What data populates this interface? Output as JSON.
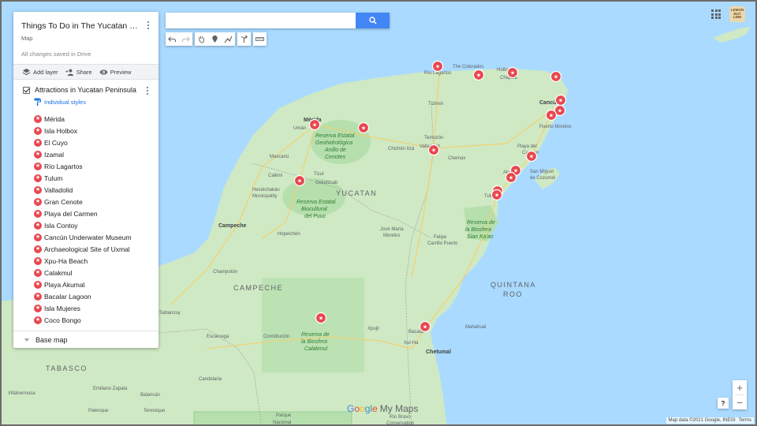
{
  "map_name": "Things To Do in The Yucatan Peninsula",
  "map_type": "Map",
  "save_status": "All changes saved in Drive",
  "actions": {
    "add_layer": "Add layer",
    "share": "Share",
    "preview": "Preview"
  },
  "layer": {
    "name": "Attractions in Yucatan Peninsula",
    "styles": "Individual styles",
    "places": [
      "Mérida",
      "Isla Holbox",
      "El Cuyo",
      "Izamal",
      "Río Lagartos",
      "Tulum",
      "Valladolid",
      "Gran Cenote",
      "Playa del Carmen",
      "Isla Contoy",
      "Cancún Underwater Museum",
      "Archaeological Site of Uxmal",
      "Xpu-Ha Beach",
      "Calakmul",
      "Playa Akumal",
      "Bacalar Lagoon",
      "Isla Mujeres",
      "Coco Bongo"
    ]
  },
  "base_map": "Base map",
  "search": {
    "value": ""
  },
  "account": "LEMON BUT LIME",
  "zoom": {
    "in": "+",
    "out": "−"
  },
  "help": "?",
  "brand": {
    "google": [
      "G",
      "o",
      "o",
      "g",
      "l",
      "e"
    ],
    "product": "My Maps"
  },
  "attribution": {
    "data": "Map data ©2021 Google, INEGI",
    "terms": "Terms"
  },
  "map_labels": {
    "merida": "Mérida",
    "yucatan": "YUCATAN",
    "campeche": "CAMPECHE",
    "quintana_roo_1": "QUINTANA",
    "quintana_roo_2": "ROO",
    "tabasco": "TABASCO",
    "campeche_city": "Campeche",
    "cancun": "Cancún",
    "playa": "Playa del",
    "carmen": "Carmen",
    "valladolid": "Valladolid",
    "tizimin": "Tizimín",
    "chetumal": "Chetumal",
    "villahermosa": "Villahermosa",
    "cuchilas": "Reserva Estatal",
    "cuchilas2": "Geohidrológica",
    "cuchilas3": "Anillo de",
    "cuchilas4": "Cenotes",
    "puuc1": "Reserva Estatal",
    "puuc2": "Biocultural",
    "puuc3": "del Puuc",
    "calakmul1": "Reserva de",
    "calakmul2": "la Biosfera",
    "calakmul3": "Calakmul",
    "siankaan1": "Reserva de",
    "siankaan2": "la Biosfera",
    "siankaan3": "Sian Ka'an",
    "cozumel1": "San Miguel",
    "cozumel2": "de Cozumel",
    "rio_lagartos": "Río Lagartos",
    "colorados": "The Colorados",
    "holbox": "Holbox",
    "chiquila": "Chiquilá",
    "champoton": "Champotón",
    "escarcega": "Escárcega",
    "hopelchen": "Hopelchén",
    "ticul": "Ticul",
    "oxkutzcab": "Oxkutzcab",
    "jose_maria": "José María",
    "morelos": "Morelos",
    "felipe": "Felipe",
    "carrillo": "Carrillo Puerto",
    "bacalar": "Bacalar",
    "xul_ha": "Xul-Ha",
    "rio_bravo": "Río Bravo",
    "conservation": "Conservation",
    "parque": "Parque",
    "nacional": "Nacional",
    "uman": "Umán",
    "chichen": "Chichén Itzá",
    "temozon": "Temozón",
    "chemax": "Chemax",
    "calkini": "Calkiní",
    "hecelchakan": "Hecelchakán",
    "municipality": "Municipality",
    "maxcanu": "Maxcanú",
    "xpujil": "Xpujil",
    "constitucion": "Constitución",
    "tulum": "Tulum",
    "puerto_morelos": "Puerto Morelos",
    "akumal": "Akumal",
    "mahahual": "Mahahual",
    "sabancuy": "Sabancuy",
    "candelaria": "Candelaria",
    "emiliano": "Emiliano Zapata",
    "balancan": "Balancán",
    "tenosique": "Tenosique",
    "palenque": "Palenque"
  }
}
